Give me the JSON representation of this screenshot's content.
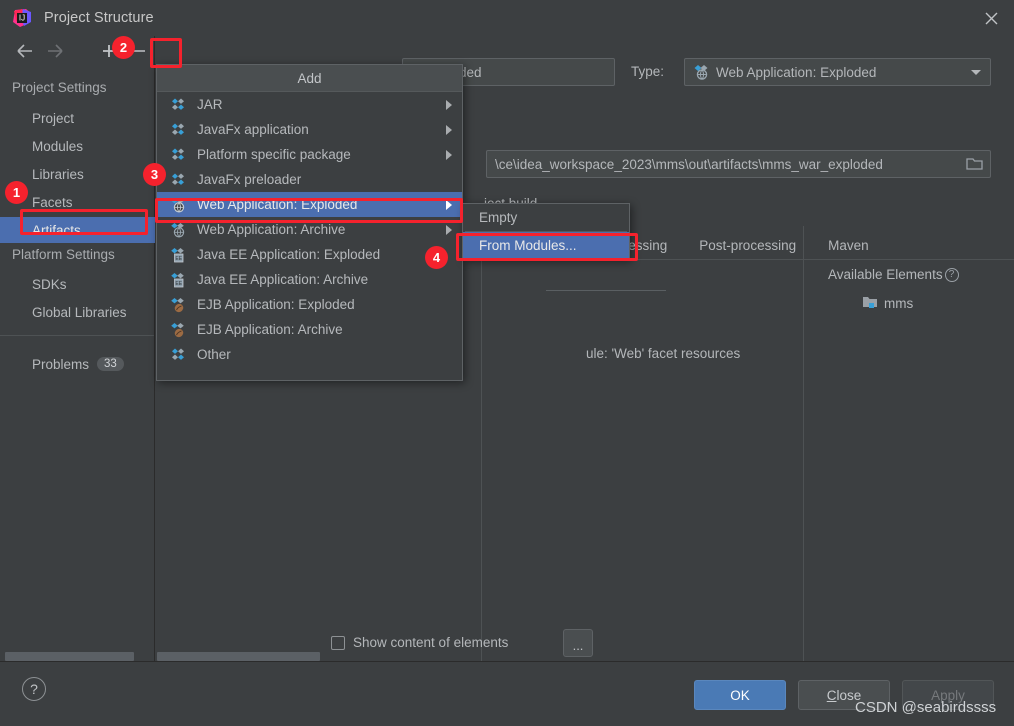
{
  "window": {
    "title": "Project Structure",
    "app_icon": "intellij-idea-icon",
    "close_icon": "close-icon"
  },
  "toolbar": {
    "back_icon": "arrow-left-icon",
    "forward_icon": "arrow-right-icon",
    "add_icon": "plus-icon",
    "remove_icon": "minus-icon",
    "copy_icon": "copy-icon"
  },
  "sidebar": {
    "groups": [
      {
        "header": "Project Settings",
        "items": [
          {
            "label": "Project",
            "selected": false
          },
          {
            "label": "Modules",
            "selected": false
          },
          {
            "label": "Libraries",
            "selected": false
          },
          {
            "label": "Facets",
            "selected": false
          },
          {
            "label": "Artifacts",
            "selected": true
          }
        ]
      },
      {
        "header": "Platform Settings",
        "items": [
          {
            "label": "SDKs",
            "selected": false
          },
          {
            "label": "Global Libraries",
            "selected": false
          }
        ]
      }
    ],
    "problems": {
      "label": "Problems",
      "badge": "33"
    }
  },
  "editor": {
    "name_value": "ar exploded",
    "type_label": "Type:",
    "type_value": "Web Application: Exploded",
    "type_icon": "web-application-exploded-icon",
    "type_caret_icon": "chevron-down-icon",
    "output_colon": ":",
    "output_path": "\\ce\\idea_workspace_2023\\mms\\out\\artifacts\\mms_war_exploded",
    "folder_icon": "folder-icon",
    "include_build_prefix": "ject ",
    "include_build_underline": "b",
    "include_build_suffix": "uild",
    "tabs": [
      {
        "label": "processing"
      },
      {
        "label": "Post-processing"
      },
      {
        "label": "Maven"
      }
    ],
    "available_elements_title": "Available Elements",
    "available_help_icon": "help-circle-icon",
    "available_items": [
      {
        "label": "mms",
        "icon": "module-folder-icon"
      }
    ],
    "tree_node_text": "ule: 'Web' facet resources",
    "show_content_label": "Show content of elements",
    "show_content_checked": false,
    "ellipsis_button": "...",
    "checkbox_icon": "checkbox-unchecked-icon"
  },
  "add_menu": {
    "title": "Add",
    "items": [
      {
        "label": "JAR",
        "icon": "artifact-jar-icon",
        "has_submenu": true,
        "highlight": false
      },
      {
        "label": "JavaFx application",
        "icon": "artifact-jar-icon",
        "has_submenu": true,
        "highlight": false
      },
      {
        "label": "Platform specific package",
        "icon": "artifact-jar-icon",
        "has_submenu": true,
        "highlight": false
      },
      {
        "label": "JavaFx preloader",
        "icon": "artifact-jar-icon",
        "has_submenu": false,
        "highlight": false
      },
      {
        "label": "Web Application: Exploded",
        "icon": "web-application-exploded-icon",
        "has_submenu": true,
        "highlight": true
      },
      {
        "label": "Web Application: Archive",
        "icon": "web-application-archive-icon",
        "has_submenu": true,
        "highlight": false
      },
      {
        "label": "Java EE Application: Exploded",
        "icon": "javaee-application-exploded-icon",
        "has_submenu": false,
        "highlight": false
      },
      {
        "label": "Java EE Application: Archive",
        "icon": "javaee-application-archive-icon",
        "has_submenu": false,
        "highlight": false
      },
      {
        "label": "EJB Application: Exploded",
        "icon": "ejb-application-exploded-icon",
        "has_submenu": false,
        "highlight": false
      },
      {
        "label": "EJB Application: Archive",
        "icon": "ejb-application-archive-icon",
        "has_submenu": false,
        "highlight": false
      },
      {
        "label": "Other",
        "icon": "artifact-jar-icon",
        "has_submenu": false,
        "highlight": false
      }
    ]
  },
  "sub_menu": {
    "items": [
      {
        "label": "Empty",
        "highlight": false
      },
      {
        "label": "From Modules...",
        "highlight": true
      }
    ]
  },
  "footer": {
    "help_icon": "help-icon",
    "ok_label": "OK",
    "close_prefix": "",
    "close_underline": "C",
    "close_suffix": "lose",
    "apply_label": "Apply"
  },
  "annotations": {
    "steps": [
      {
        "number": "1"
      },
      {
        "number": "2"
      },
      {
        "number": "3"
      },
      {
        "number": "4"
      }
    ],
    "accent_color": "#f5222d",
    "highlight_color": "#4b6eaf"
  },
  "watermark": "CSDN @seabirdssss"
}
